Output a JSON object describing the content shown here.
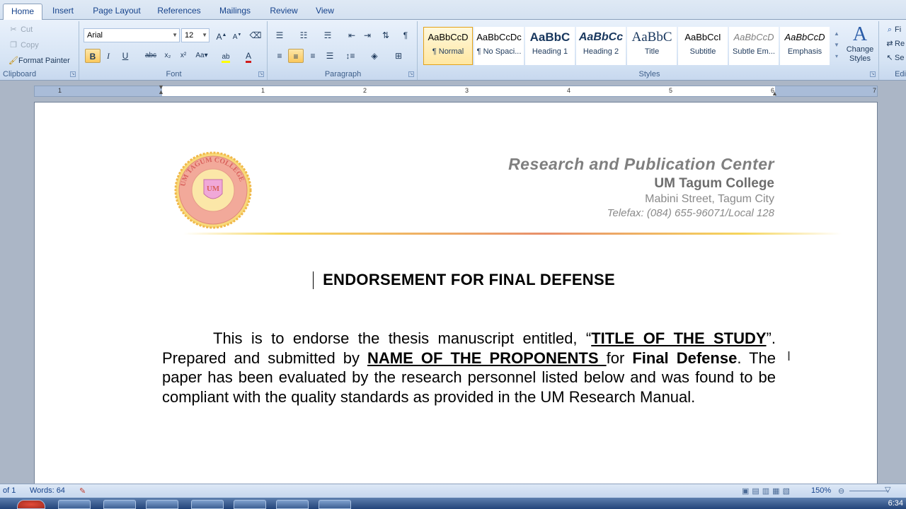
{
  "tabs": [
    "Home",
    "Insert",
    "Page Layout",
    "References",
    "Mailings",
    "Review",
    "View"
  ],
  "clipboard": {
    "cut": "Cut",
    "copy": "Copy",
    "format_painter": "Format Painter",
    "label": "Clipboard"
  },
  "font": {
    "name": "Arial",
    "size": "12",
    "label": "Font",
    "color_accent": "#d01c1c",
    "highlight_color": "#ffff00"
  },
  "paragraph": {
    "label": "Paragraph"
  },
  "styles": {
    "label": "Styles",
    "items": [
      {
        "sample": "AaBbCcD",
        "name": "¶ Normal"
      },
      {
        "sample": "AaBbCcDc",
        "name": "¶ No Spaci..."
      },
      {
        "sample": "AaBbC",
        "name": "Heading 1"
      },
      {
        "sample": "AaBbCc",
        "name": "Heading 2"
      },
      {
        "sample": "AaBbC",
        "name": "Title"
      },
      {
        "sample": "AaBbCcI",
        "name": "Subtitle"
      },
      {
        "sample": "AaBbCcD",
        "name": "Subtle Em..."
      },
      {
        "sample": "AaBbCcD",
        "name": "Emphasis"
      }
    ],
    "change_styles_line1": "Change",
    "change_styles_line2": "Styles"
  },
  "editing": {
    "find": "Fi",
    "replace": "Re",
    "select": "Se",
    "label": "Edi"
  },
  "ruler": {
    "numbers": [
      "1",
      "1",
      "2",
      "3",
      "4",
      "5",
      "6",
      "7"
    ]
  },
  "document": {
    "header_line1": "Research and Publication Center",
    "header_line2": "UM Tagum College",
    "header_line3": "Mabini Street, Tagum City",
    "header_line4": "Telefax: (084) 655-96071/Local 128",
    "seal_text": "UM TAGUM COLLEGE",
    "title": "ENDORSEMENT FOR FINAL DEFENSE",
    "para_part1": "This is to endorse the thesis manuscript entitled, “",
    "para_study_title": "TITLE OF THE STUDY",
    "para_part2": "”. Prepared and submitted by ",
    "para_proponents": "NAME OF THE PROPONENTS ",
    "para_part3": "for ",
    "para_final_defense": "Final Defense",
    "para_part4": ". The paper has been evaluated by the research personnel listed below and was found to be compliant with the quality standards as provided in the UM Research Manual."
  },
  "status": {
    "page": "of 1",
    "words": "Words: 64",
    "zoom": "150%"
  },
  "taskbar": {
    "clock": "6:34"
  }
}
